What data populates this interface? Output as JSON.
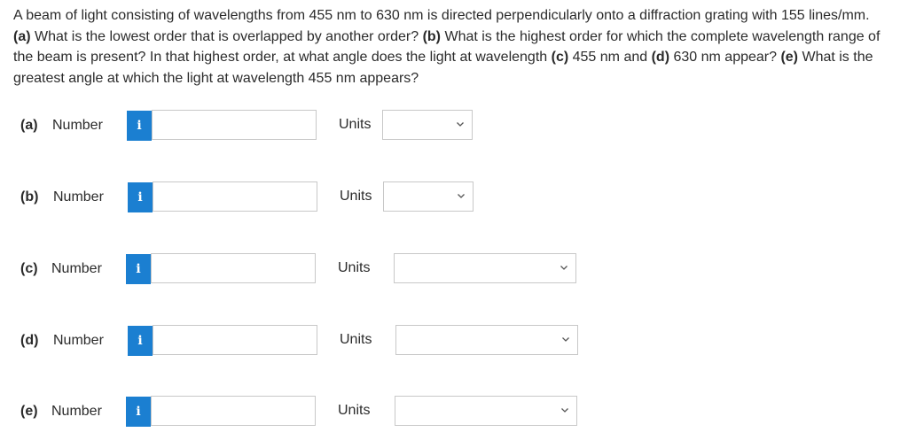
{
  "question": {
    "segments": [
      {
        "text": "A beam of light consisting of wavelengths from 455 nm to 630 nm is directed perpendicularly onto a diffraction grating with 155 lines/mm. ",
        "bold": false
      },
      {
        "text": "(a)",
        "bold": true
      },
      {
        "text": " What is the lowest order that is overlapped by another order? ",
        "bold": false
      },
      {
        "text": "(b)",
        "bold": true
      },
      {
        "text": " What is the highest order for which the complete wavelength range of the beam is present? In that highest order, at what angle does the light at wavelength ",
        "bold": false
      },
      {
        "text": "(c)",
        "bold": true
      },
      {
        "text": " 455 nm and ",
        "bold": false
      },
      {
        "text": "(d)",
        "bold": true
      },
      {
        "text": " 630 nm appear? ",
        "bold": false
      },
      {
        "text": "(e)",
        "bold": true
      },
      {
        "text": " What is the greatest angle at which the light at wavelength 455 nm appears?",
        "bold": false
      }
    ]
  },
  "parts": [
    {
      "label": "(a)",
      "number_label": "Number",
      "info_icon": "i",
      "value": "",
      "units_label": "Units",
      "units_value": ""
    },
    {
      "label": "(b)",
      "number_label": "Number",
      "info_icon": "i",
      "value": "",
      "units_label": "Units",
      "units_value": ""
    },
    {
      "label": "(c)",
      "number_label": "Number",
      "info_icon": "i",
      "value": "",
      "units_label": "Units",
      "units_value": ""
    },
    {
      "label": "(d)",
      "number_label": "Number",
      "info_icon": "i",
      "value": "",
      "units_label": "Units",
      "units_value": ""
    },
    {
      "label": "(e)",
      "number_label": "Number",
      "info_icon": "i",
      "value": "",
      "units_label": "Units",
      "units_value": ""
    }
  ],
  "colors": {
    "info_button": "#1b7fd1",
    "input_border": "#c8c8c8",
    "text": "#2b2b2b"
  }
}
